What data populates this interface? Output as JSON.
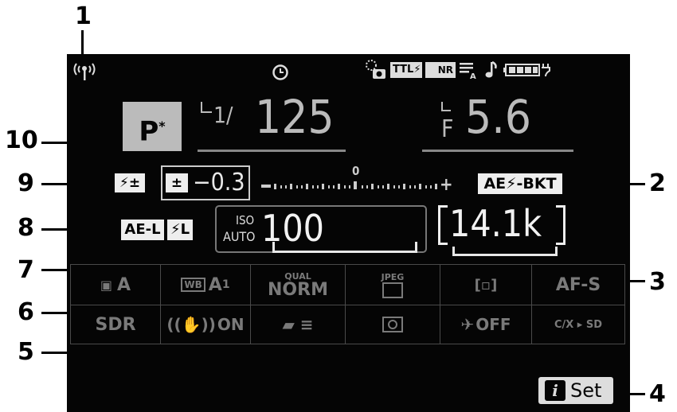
{
  "callouts": [
    "1",
    "2",
    "3",
    "4",
    "5",
    "6",
    "7",
    "8",
    "9",
    "10"
  ],
  "status_bar": {
    "wireless_icon": "antenna-icon",
    "clock_icon": "clock-icon",
    "location_icon": "location-icon",
    "ttl_label": "TTL",
    "nr_label": "NR",
    "beep_icon": "note-icon",
    "battery_icon": "battery-icon"
  },
  "exposure": {
    "mode": "P",
    "mode_star": "*",
    "shutter": "125",
    "shutter_prefix": "1/",
    "aperture": "5.6",
    "aperture_prefix": "F"
  },
  "flash_comp_label": "",
  "exp_comp": "−0.3",
  "meter_zero": "0",
  "meter_plus": "+",
  "meter_minus": "−",
  "bracketing": "AE⚡-BKT",
  "ae_lock": "AE-L",
  "fv_lock": "L",
  "iso": {
    "top": "ISO",
    "bottom": "AUTO",
    "value": "100"
  },
  "remaining": "14.1k",
  "grid": [
    [
      "A",
      "A",
      "NORM",
      "",
      "[▫]",
      "AF-S"
    ],
    [
      "SDR",
      "ON",
      "",
      "",
      "OFF",
      ""
    ]
  ],
  "grid_small": [
    "",
    "WB",
    "QUAL",
    "JPEG",
    "",
    ""
  ],
  "set_button": "Set",
  "info_glyph": "i"
}
